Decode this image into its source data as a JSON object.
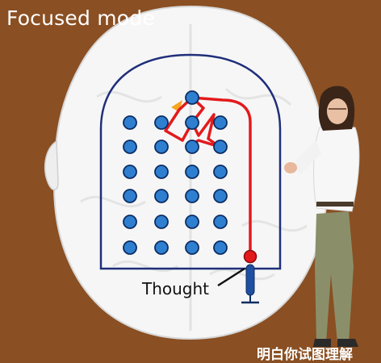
{
  "title": "Focused mode",
  "label_thought": "Thought",
  "subtitle_partial": "明白你试图理解",
  "colors": {
    "background": "#8a4f22",
    "brain": "#f6f6f6",
    "frame": "#1f2f7a",
    "node_fill": "#2f7fd0",
    "node_stroke": "#0d2d63",
    "path": "#e31a1c",
    "highlight": "#f5a623"
  },
  "node_grid": {
    "columns": 4,
    "rows": 6,
    "top_row_count": 1,
    "top_row_column": 3
  }
}
